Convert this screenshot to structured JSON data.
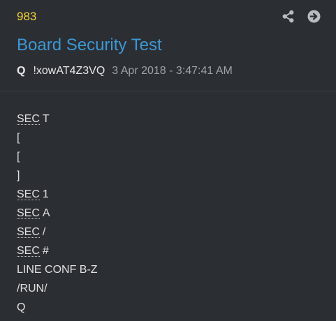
{
  "post": {
    "number": "983",
    "title": "Board Security Test",
    "author": "Q",
    "tripcode": "!xowAT4Z3VQ",
    "timestamp": "3 Apr 2018 - 3:47:41 AM"
  },
  "icons": {
    "share": "share-icon",
    "goto": "arrow-circle-right-icon"
  },
  "colors": {
    "background": "#2b2e33",
    "post_number": "#f3d338",
    "title": "#3d97d3",
    "text": "#e0e0e0",
    "date": "#9ea3a9",
    "icon": "#b8bcc1"
  },
  "body": {
    "lines": [
      {
        "abbr": "SEC",
        "rest": "T"
      },
      {
        "abbr": "",
        "rest": "["
      },
      {
        "abbr": "",
        "rest": "["
      },
      {
        "abbr": "",
        "rest": "]"
      },
      {
        "abbr": "SEC",
        "rest": "1"
      },
      {
        "abbr": "SEC",
        "rest": "A"
      },
      {
        "abbr": "SEC",
        "rest": "/"
      },
      {
        "abbr": "SEC",
        "rest": "#"
      },
      {
        "abbr": "",
        "rest": "LINE CONF B-Z"
      },
      {
        "abbr": "",
        "rest": "/RUN/"
      },
      {
        "abbr": "",
        "rest": "Q"
      }
    ]
  }
}
